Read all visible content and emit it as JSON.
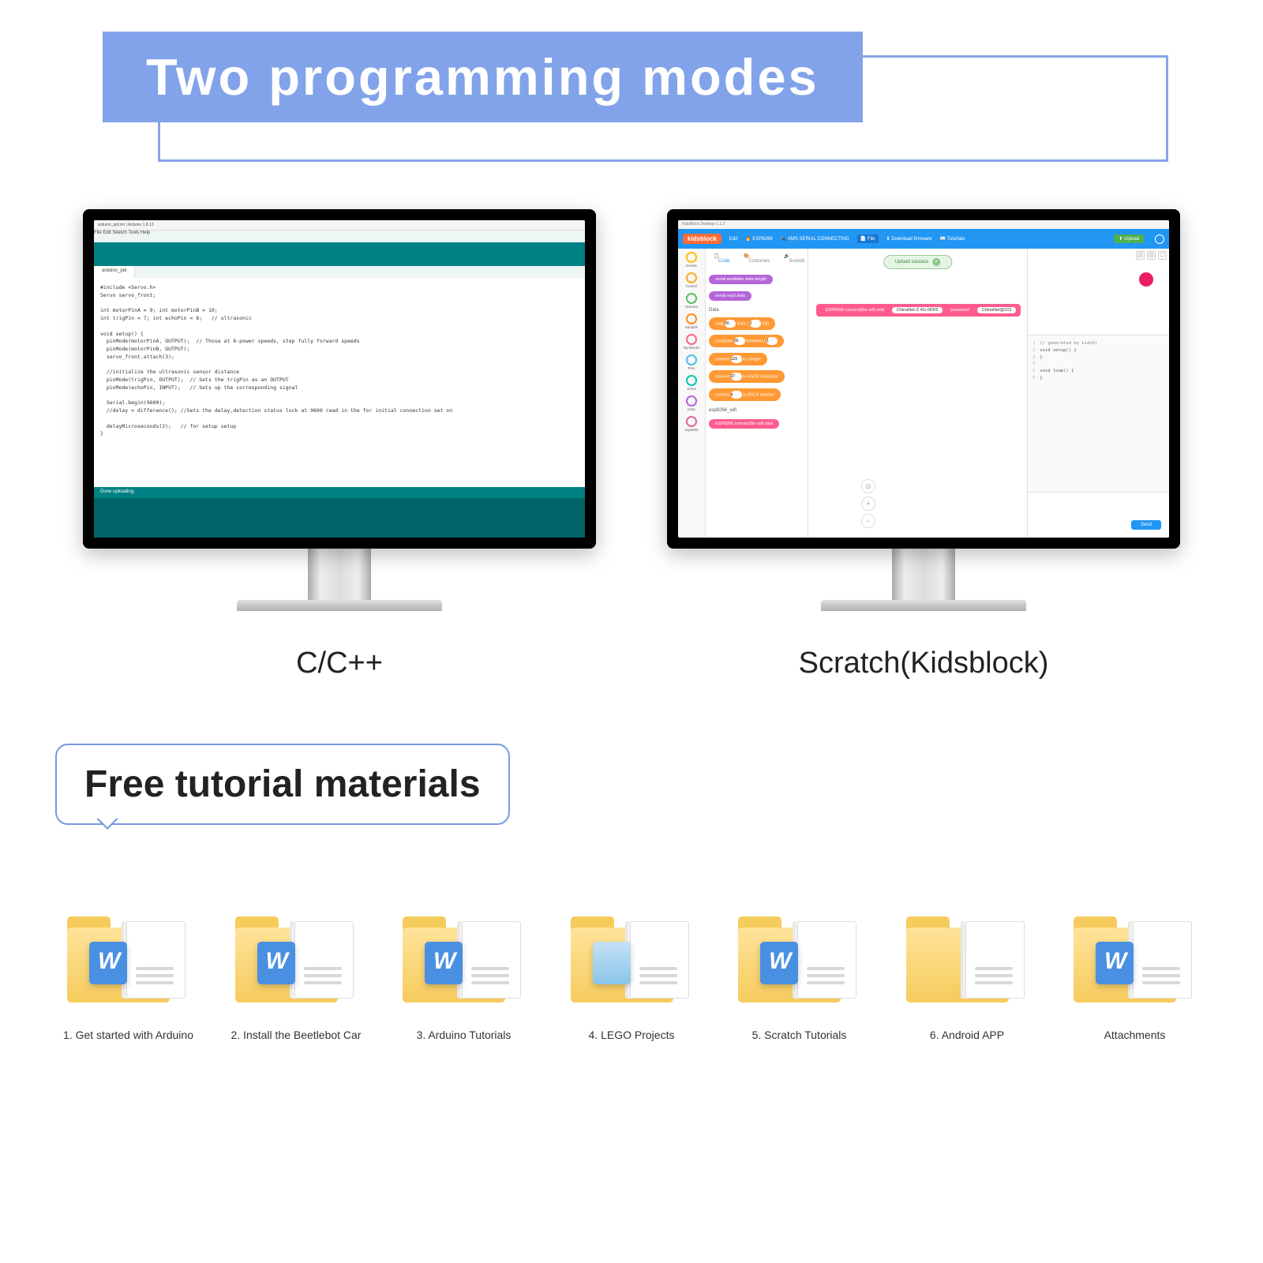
{
  "title": "Two programming modes",
  "monitors": {
    "left": {
      "label": "C/C++",
      "window_title": "arduino_pid.ino | Arduino 1.8.13",
      "tab": "File Edit Sketch Tools Help",
      "sketch_tab": "arduino_pid",
      "status": "Done uploading.",
      "code_lines": [
        "#include <Servo.h>",
        "Servo servo_front;",
        "",
        "int motorPinA = 9; int motorPinB = 10;",
        "int trigPin = 7; int echoPin = 8;   // ultrasonic",
        "",
        "void setup() {",
        "  pinMode(motorPinA, OUTPUT);  // Those at 8-power speeds, step fully forward speeds",
        "  pinMode(motorPinB, OUTPUT);",
        "  servo_front.attach(3);",
        "",
        "  //initialize the ultrasonic sensor distance",
        "  pinMode(trigPin, OUTPUT);  // Sets the trigPin as an OUTPUT",
        "  pinMode(echoPin, INPUT);   // Sets up the corresponding signal",
        "",
        "  Serial.begin(9600);",
        "  //delay = difference(); //Sets the delay,detection status lock at 9600 read in the for initial connection set on",
        "",
        "  delayMicroseconds(2);   // for setup setup",
        "}"
      ]
    },
    "right": {
      "label": "Scratch(Kidsblock)",
      "window_title": "KidsBlock Desktop 1.1.3",
      "brand": "kidsblock",
      "toolbar_items": [
        "Edit",
        "ESP8266",
        "XMS SERIAL CONNECTING",
        "File"
      ],
      "download_btn": "Download firmware",
      "tutorials_btn": "Tutorials",
      "upload_btn": "Upload",
      "success_msg": "Upload success",
      "categories": [
        {
          "name": "Events",
          "color": "#ffbf00"
        },
        {
          "name": "Control",
          "color": "#ffab19"
        },
        {
          "name": "Operato",
          "color": "#59c059"
        },
        {
          "name": "Variable",
          "color": "#ff8c1a"
        },
        {
          "name": "My Blocks",
          "color": "#ff6680"
        },
        {
          "name": "Pins",
          "color": "#4cbfe6"
        },
        {
          "name": "Serial",
          "color": "#00c9b0"
        },
        {
          "name": "Data",
          "color": "#b565d9"
        },
        {
          "name": "esp8266",
          "color": "#e066a3"
        }
      ],
      "palette_tabs": [
        "Code",
        "Costumes",
        "Sounds"
      ],
      "palette_blocks": [
        "serial available data length",
        "serial read data"
      ],
      "data_label": "Data",
      "data_blocks": [
        {
          "text": "map",
          "v1": "50",
          "text2": "from (",
          "v2": "1",
          "text3": "100"
        },
        {
          "text": "constrain",
          "v1": "50",
          "text2": "between (",
          "v2": "1"
        },
        {
          "text": "convert",
          "v1": "123",
          "text2": "to integer"
        },
        {
          "text": "convert",
          "v1": "97",
          "text2": "to ASCII character"
        },
        {
          "text": "convert",
          "v1": "a",
          "text2": "to ASCII number"
        }
      ],
      "wifi_label": "esp8266_wifi",
      "wifi_block": "ESP8266 connect|for wifi ssid",
      "canvas_block": {
        "prefix": "ESP8266 connect|the wifi ssid",
        "ssid": "ChinaNet-Z 4G-0DF8",
        "mid": "password",
        "pwd": "ChinaNet@223"
      },
      "code_preview": [
        "// generated by kidsbl",
        "void setup() {",
        "}",
        "",
        "void loop() {",
        "}"
      ],
      "send_btn": "Send"
    }
  },
  "tutorial_title": "Free tutorial materials",
  "folders": [
    {
      "label": "1. Get started with Arduino",
      "type": "w"
    },
    {
      "label": "2. Install the Beetlebot Car",
      "type": "w"
    },
    {
      "label": "3. Arduino Tutorials",
      "type": "w"
    },
    {
      "label": "4. LEGO Projects",
      "type": "pic"
    },
    {
      "label": "5. Scratch Tutorials",
      "type": "w"
    },
    {
      "label": "6. Android APP",
      "type": "plain"
    },
    {
      "label": "Attachments",
      "type": "w"
    }
  ]
}
